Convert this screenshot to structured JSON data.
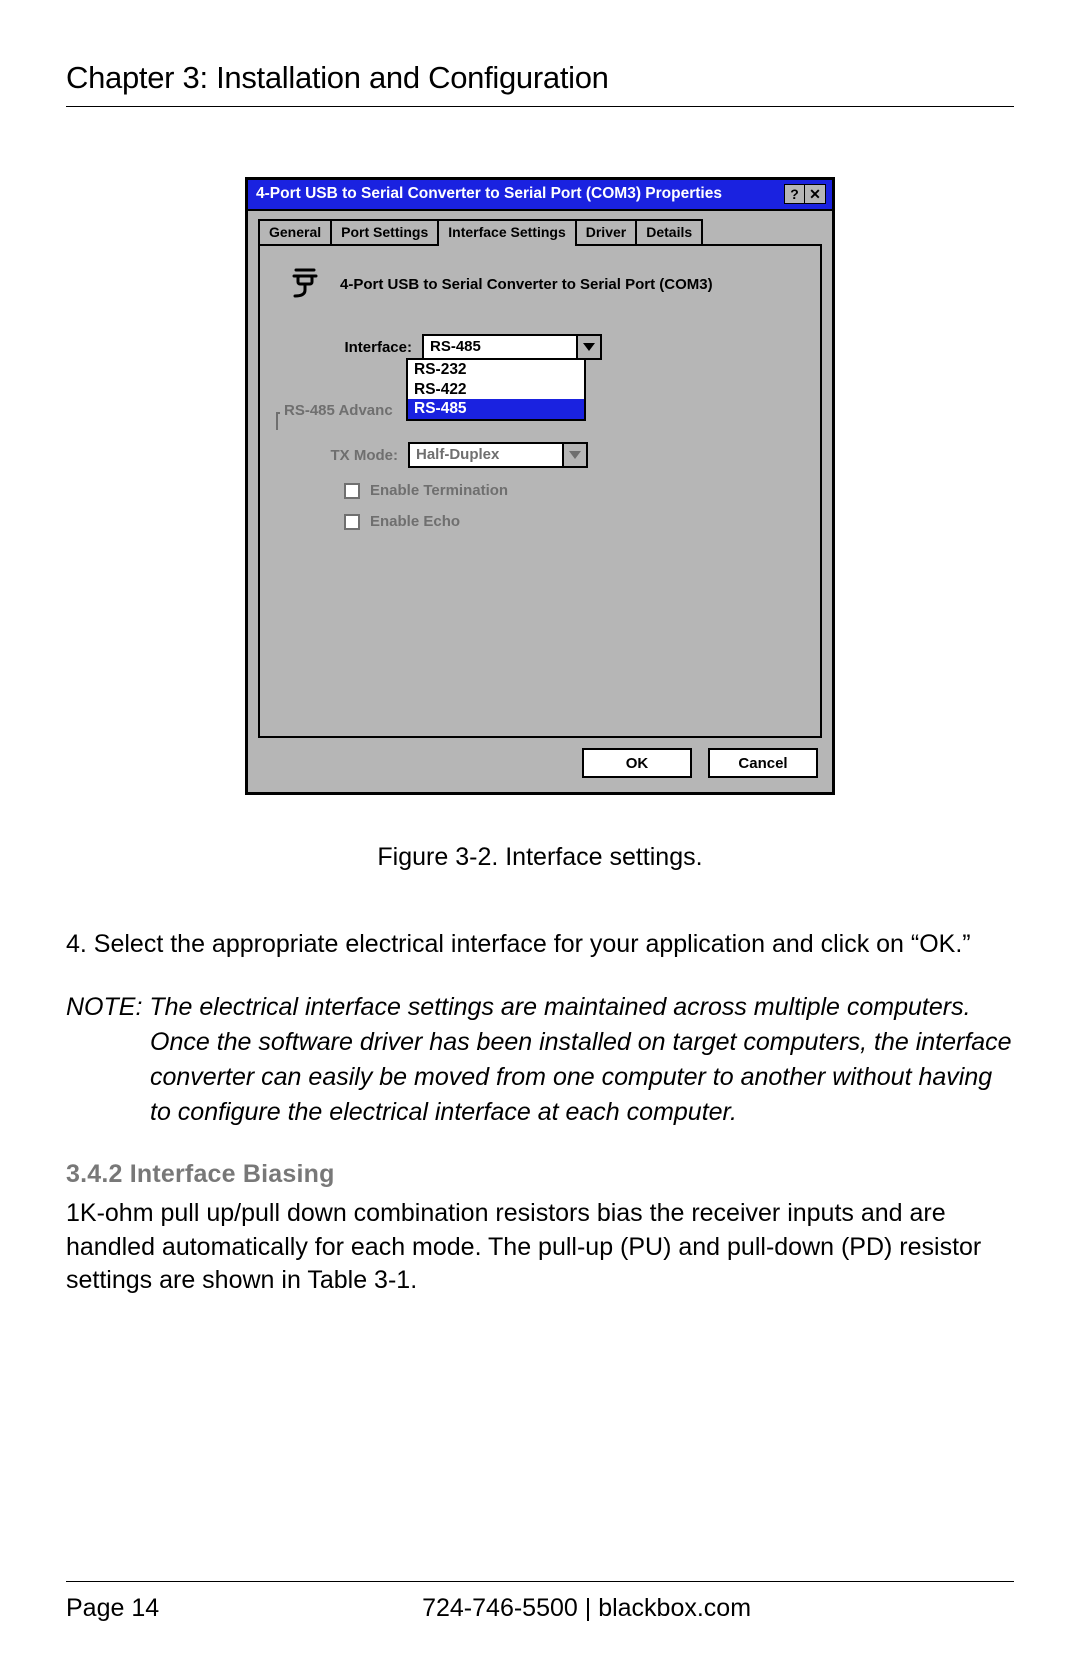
{
  "chapter_title": "Chapter 3: Installation and Configuration",
  "dialog": {
    "title": "4-Port USB to Serial Converter to Serial Port (COM3) Properties",
    "help_btn": "?",
    "close_btn": "✕",
    "tabs": [
      "General",
      "Port Settings",
      "Interface Settings",
      "Driver",
      "Details"
    ],
    "active_tab_index": 2,
    "header_text": "4-Port USB to Serial Converter to Serial Port (COM3)",
    "interface_label": "Interface:",
    "interface_value": "RS-485",
    "interface_options": [
      "RS-232",
      "RS-422",
      "RS-485"
    ],
    "interface_selected_index": 2,
    "advanced_legend": "RS-485 Advanc",
    "txmode_label": "TX Mode:",
    "txmode_value": "Half-Duplex",
    "chk_termination": "Enable Termination",
    "chk_echo": "Enable Echo",
    "ok": "OK",
    "cancel": "Cancel"
  },
  "figure_caption": "Figure 3-2. Interface settings.",
  "step4": "4. Select the appropriate electrical interface for your application and click on “OK.”",
  "note_lead": "NOTE: ",
  "note_body": "The electrical interface settings are maintained across multiple computers. Once the software driver has been installed on target computers, the interface converter can easily be moved from one computer to another without having to configure the electrical interface at each computer.",
  "section_heading": "3.4.2 Interface Biasing",
  "biasing_text": "1K-ohm pull up/pull down combination resistors bias the receiver inputs and are handled automatically for each mode. The pull-up (PU) and pull-down (PD) resistor settings are shown in Table 3-1.",
  "footer": {
    "page": "Page 14",
    "phone": "724-746-5500",
    "sep": "   |   ",
    "site": "blackbox.com"
  }
}
